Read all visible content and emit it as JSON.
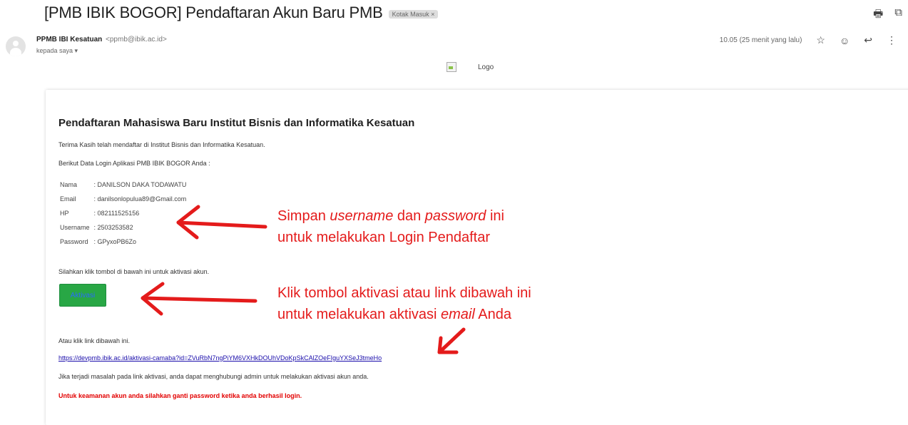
{
  "header": {
    "subject": "[PMB IBIK BOGOR] Pendaftaran Akun Baru PMB",
    "label_chip": "Kotak Masuk ×"
  },
  "sender": {
    "name": "PPMB IBI Kesatuan",
    "email": "<ppmb@ibik.ac.id>",
    "to": "kepada saya ▾",
    "time": "10.05 (25 menit yang lalu)"
  },
  "logo": {
    "alt_text": "Logo"
  },
  "email": {
    "title": "Pendaftaran Mahasiswa Baru Institut Bisnis dan Informatika Kesatuan",
    "thanks": "Terima Kasih telah mendaftar di Institut Bisnis dan Informatika Kesatuan.",
    "intro": "Berikut Data Login Aplikasi PMB IBIK BOGOR Anda :",
    "credentials": [
      {
        "label": "Nama",
        "value": ": DANILSON DAKA TODAWATU"
      },
      {
        "label": "Email",
        "value": ": danilsonlopulua89@Gmail.com"
      },
      {
        "label": "HP",
        "value": ": 082111525156"
      },
      {
        "label": "Username",
        "value": ": 2503253582"
      },
      {
        "label": "Password",
        "value": ": GPyxoPB6Zo"
      }
    ],
    "activate_prompt": "Silahkan klik tombol di bawah ini untuk aktivasi akun.",
    "activate_button": "Aktivasi",
    "link_prompt": "Atau klik link dibawah ini.",
    "activation_link": "https://devpmb.ibik.ac.id/aktivasi-camaba?id=ZVuRbN7ngPiYM6VXHkDOUhVDoKpSkCAlZOeFIguYXSeJ3tmeHo",
    "help_text": "Jika terjadi masalah pada link aktivasi, anda dapat menghubungi admin untuk melakukan aktivasi akun anda.",
    "warning": "Untuk keamanan akun anda silahkan ganti password ketika anda berhasil login."
  },
  "annotations": {
    "note1": {
      "part1": "Simpan ",
      "em1": "username",
      "part2": " dan ",
      "em2": "password",
      "part3": " ini",
      "line2": "untuk melakukan Login Pendaftar"
    },
    "note2": {
      "line1": "Klik tombol aktivasi atau link dibawah ini",
      "part1": "untuk melakukan aktivasi ",
      "em": "email",
      "part2": " Anda"
    }
  },
  "icons": {
    "print": "print-icon",
    "open_new": "open-in-new-window-icon",
    "star": "star-icon",
    "emoji": "emoji-icon",
    "reply": "reply-icon",
    "more": "more-vert-icon"
  },
  "colors": {
    "annotation_red": "#e41b1b",
    "button_green": "#28a745",
    "warning_red": "#e30000",
    "link_blue": "#1a0dab"
  }
}
